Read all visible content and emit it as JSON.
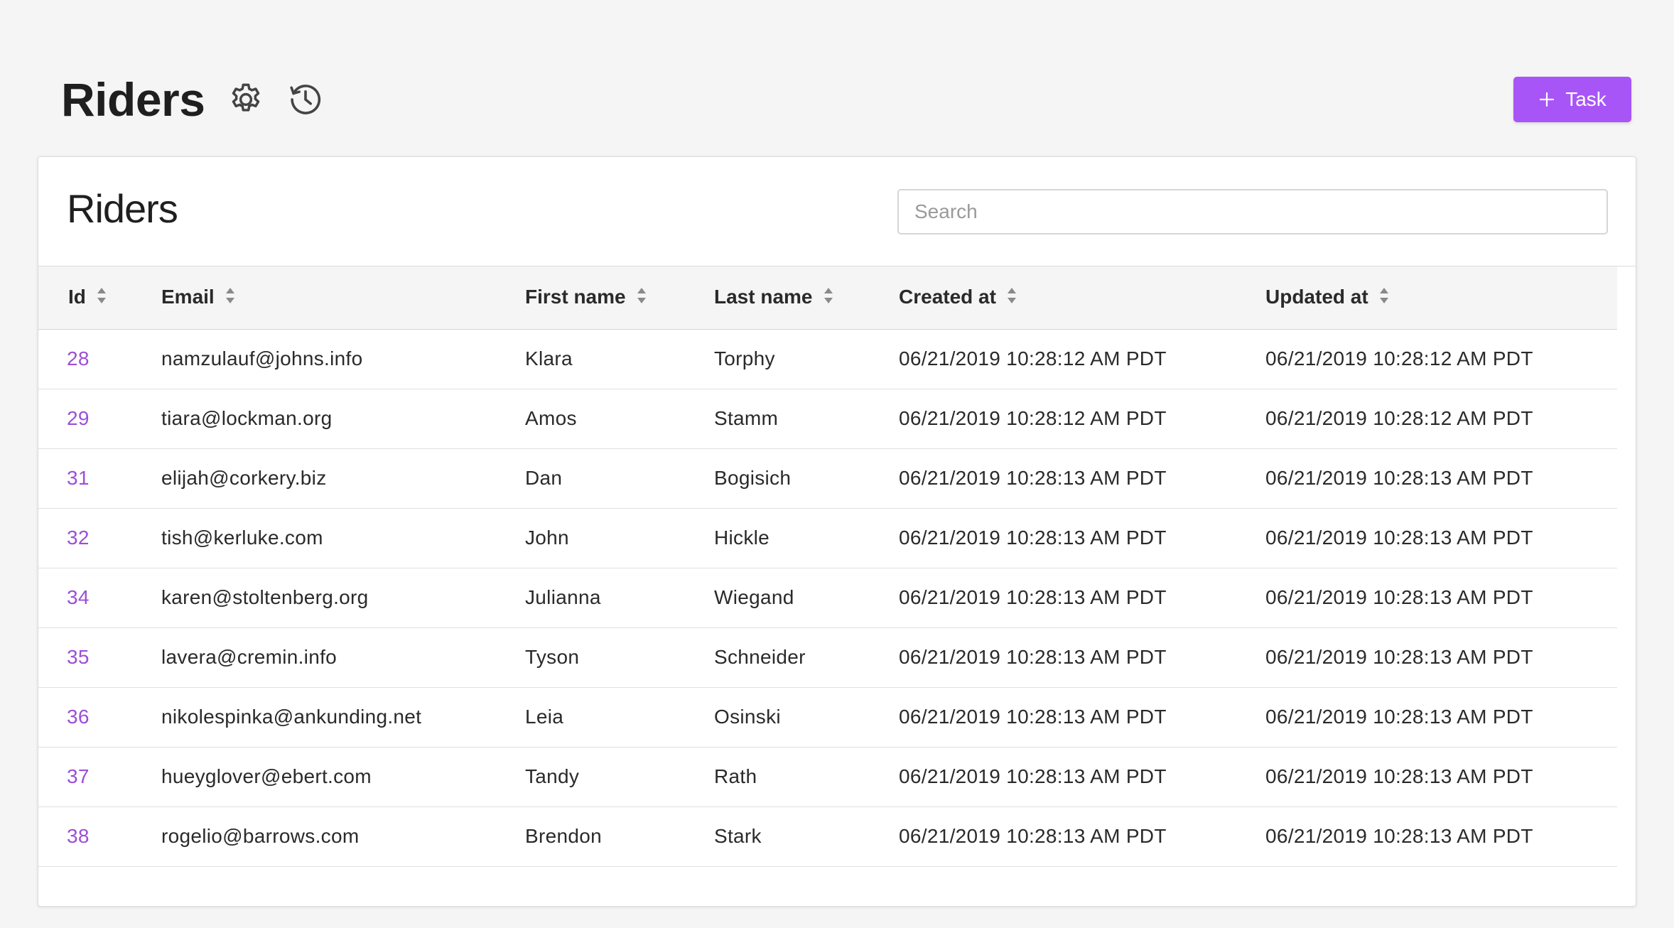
{
  "page": {
    "title": "Riders",
    "task_button_label": "Task"
  },
  "card": {
    "title": "Riders",
    "search_placeholder": "Search"
  },
  "table": {
    "columns": [
      "Id",
      "Email",
      "First name",
      "Last name",
      "Created at",
      "Updated at"
    ],
    "rows": [
      [
        "28",
        "namzulauf@johns.info",
        "Klara",
        "Torphy",
        "06/21/2019 10:28:12 AM PDT",
        "06/21/2019 10:28:12 AM PDT"
      ],
      [
        "29",
        "tiara@lockman.org",
        "Amos",
        "Stamm",
        "06/21/2019 10:28:12 AM PDT",
        "06/21/2019 10:28:12 AM PDT"
      ],
      [
        "31",
        "elijah@corkery.biz",
        "Dan",
        "Bogisich",
        "06/21/2019 10:28:13 AM PDT",
        "06/21/2019 10:28:13 AM PDT"
      ],
      [
        "32",
        "tish@kerluke.com",
        "John",
        "Hickle",
        "06/21/2019 10:28:13 AM PDT",
        "06/21/2019 10:28:13 AM PDT"
      ],
      [
        "34",
        "karen@stoltenberg.org",
        "Julianna",
        "Wiegand",
        "06/21/2019 10:28:13 AM PDT",
        "06/21/2019 10:28:13 AM PDT"
      ],
      [
        "35",
        "lavera@cremin.info",
        "Tyson",
        "Schneider",
        "06/21/2019 10:28:13 AM PDT",
        "06/21/2019 10:28:13 AM PDT"
      ],
      [
        "36",
        "nikolespinka@ankunding.net",
        "Leia",
        "Osinski",
        "06/21/2019 10:28:13 AM PDT",
        "06/21/2019 10:28:13 AM PDT"
      ],
      [
        "37",
        "hueyglover@ebert.com",
        "Tandy",
        "Rath",
        "06/21/2019 10:28:13 AM PDT",
        "06/21/2019 10:28:13 AM PDT"
      ],
      [
        "38",
        "rogelio@barrows.com",
        "Brendon",
        "Stark",
        "06/21/2019 10:28:13 AM PDT",
        "06/21/2019 10:28:13 AM PDT"
      ]
    ]
  },
  "icons": {
    "settings": "gear-icon",
    "history": "history-icon",
    "add": "plus-icon",
    "sort": "sort-icon"
  },
  "colors": {
    "accent": "#a855f7",
    "link": "#9b4fd6",
    "background": "#f5f5f5"
  }
}
